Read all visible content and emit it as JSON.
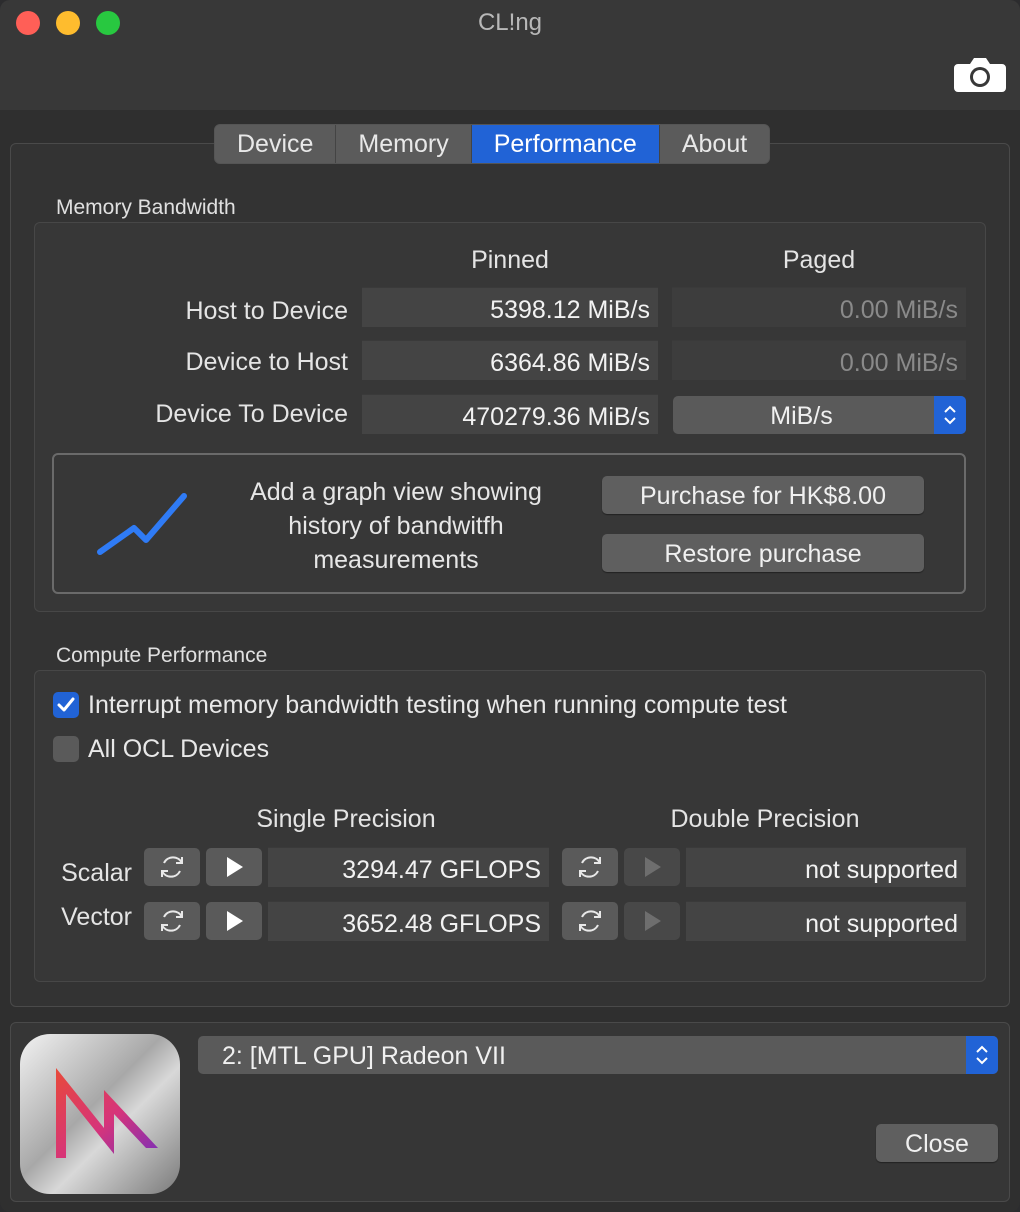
{
  "window": {
    "title": "CL!ng"
  },
  "tabs": [
    {
      "label": "Device"
    },
    {
      "label": "Memory"
    },
    {
      "label": "Performance"
    },
    {
      "label": "About"
    }
  ],
  "memory_bandwidth": {
    "section_title": "Memory Bandwidth",
    "col_pinned": "Pinned",
    "col_paged": "Paged",
    "rows": [
      {
        "label": "Host to Device",
        "pinned": "5398.12 MiB/s",
        "paged": "0.00 MiB/s"
      },
      {
        "label": "Device to Host",
        "pinned": "6364.86 MiB/s",
        "paged": "0.00 MiB/s"
      },
      {
        "label": "Device To Device",
        "pinned": "470279.36 MiB/s",
        "paged_unit": "MiB/s"
      }
    ],
    "promo_text": "Add a graph view showing history of bandwitfh measurements",
    "purchase_button": "Purchase for HK$8.00",
    "restore_button": "Restore purchase"
  },
  "compute_performance": {
    "section_title": "Compute Performance",
    "interrupt_checkbox": {
      "label": "Interrupt memory bandwidth testing when running compute test",
      "checked": true
    },
    "all_devices_checkbox": {
      "label": "All OCL Devices",
      "checked": false
    },
    "col_single": "Single Precision",
    "col_double": "Double Precision",
    "rows": [
      {
        "label": "Scalar",
        "single": "3294.47 GFLOPS",
        "double": "not supported"
      },
      {
        "label": "Vector",
        "single": "3652.48 GFLOPS",
        "double": "not supported"
      }
    ]
  },
  "bottom": {
    "device_select": "2: [MTL GPU] Radeon VII",
    "close_button": "Close"
  },
  "colors": {
    "accent": "#2163d6",
    "graph_line": "#2f7bf5"
  }
}
